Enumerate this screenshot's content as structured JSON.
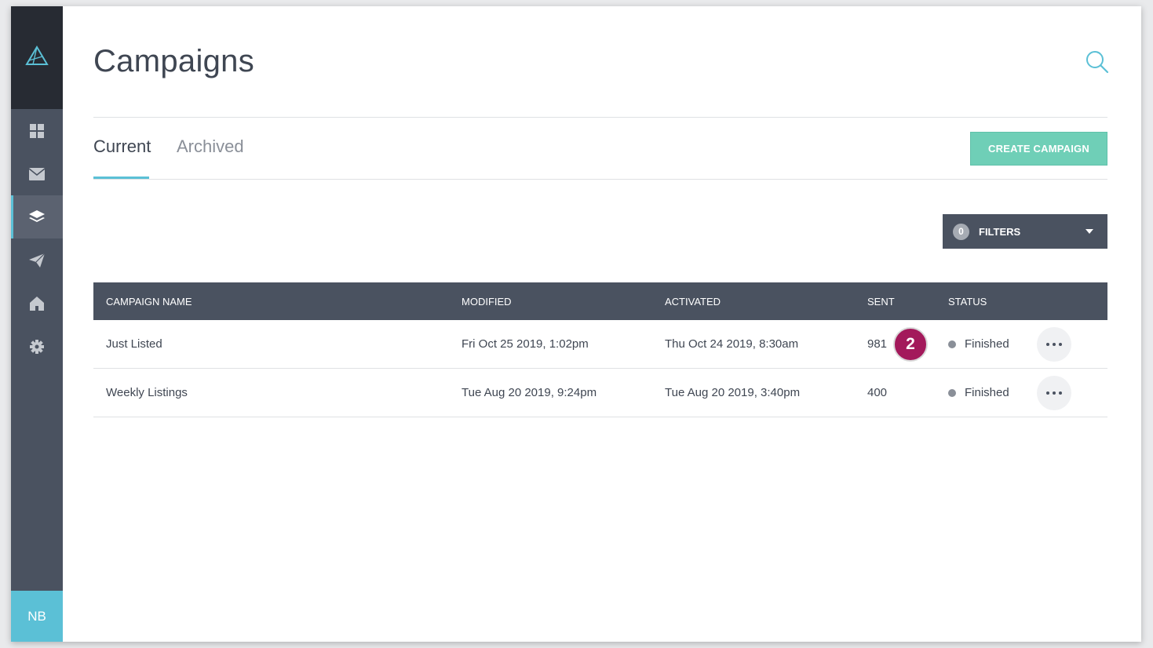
{
  "app": {
    "page_title": "Campaigns",
    "accent_color": "#5bc0d6",
    "primary_button_color": "#6fcfb7",
    "sidebar_color": "#4a5260"
  },
  "sidebar": {
    "logo_icon": "triangle-logo-icon",
    "items": [
      {
        "icon": "dashboard-grid-icon",
        "active": false
      },
      {
        "icon": "envelope-icon",
        "active": false
      },
      {
        "icon": "layers-icon",
        "active": true
      },
      {
        "icon": "paper-plane-icon",
        "active": false
      },
      {
        "icon": "home-icon",
        "active": false
      },
      {
        "icon": "gear-icon",
        "active": false
      }
    ],
    "user_initials": "NB"
  },
  "header": {
    "search_icon": "search-icon"
  },
  "tabs": [
    {
      "label": "Current",
      "active": true
    },
    {
      "label": "Archived",
      "active": false
    }
  ],
  "toolbar": {
    "create_label": "CREATE CAMPAIGN",
    "filters_count": "0",
    "filters_label": "FILTERS"
  },
  "table": {
    "columns": [
      "CAMPAIGN NAME",
      "MODIFIED",
      "ACTIVATED",
      "SENT",
      "STATUS"
    ],
    "rows": [
      {
        "name": "Just Listed",
        "modified": "Fri Oct 25 2019, 1:02pm",
        "activated": "Thu Oct 24 2019, 8:30am",
        "sent": "981",
        "status": "Finished"
      },
      {
        "name": "Weekly Listings",
        "modified": "Tue Aug 20 2019, 9:24pm",
        "activated": "Tue Aug 20 2019, 3:40pm",
        "sent": "400",
        "status": "Finished"
      }
    ]
  },
  "annotation": {
    "step_number": "2"
  }
}
